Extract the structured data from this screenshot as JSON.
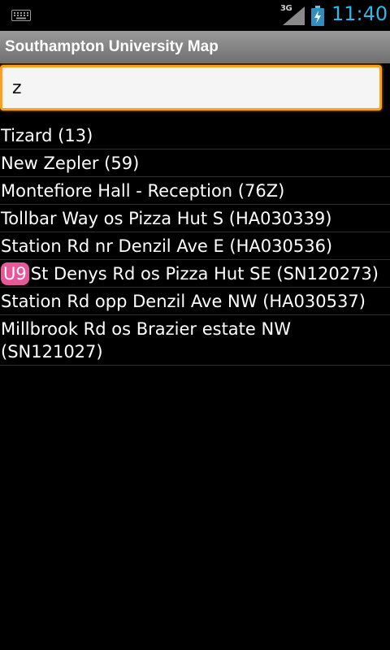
{
  "status_bar": {
    "network": "3G",
    "time": "11:40",
    "time_color": "#33b5e5",
    "icons": [
      "keyboard-icon",
      "signal-icon",
      "battery-charging-icon"
    ]
  },
  "app": {
    "title": "Southampton University Map"
  },
  "search": {
    "value": "z",
    "focus_color": "#ff9f1a"
  },
  "results": [
    {
      "badge": "",
      "label": "Tizard (13)"
    },
    {
      "badge": "",
      "label": "New Zepler (59)"
    },
    {
      "badge": "",
      "label": "Montefiore Hall - Reception (76Z)"
    },
    {
      "badge": "",
      "label": "Tollbar Way os Pizza Hut S (HA030339)"
    },
    {
      "badge": "",
      "label": "Station Rd nr Denzil Ave E (HA030536)"
    },
    {
      "badge": "U9",
      "label": "St Denys Rd os Pizza Hut SE (SN120273)",
      "badge_color": "#e8579a"
    },
    {
      "badge": "",
      "label": "Station Rd opp Denzil Ave NW (HA030537)"
    },
    {
      "badge": "",
      "label": "Millbrook Rd os Brazier estate NW (SN121027)"
    }
  ]
}
